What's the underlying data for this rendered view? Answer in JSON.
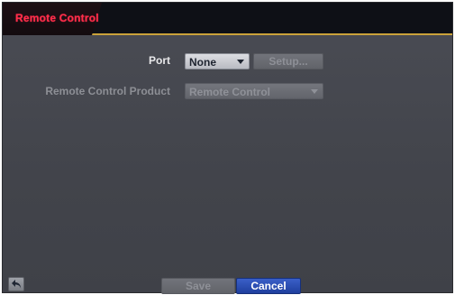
{
  "window": {
    "title": "Remote Control"
  },
  "form": {
    "port": {
      "label": "Port",
      "value": "None",
      "setup_label": "Setup..."
    },
    "product": {
      "label": "Remote Control Product",
      "value": "Remote Control"
    }
  },
  "footer": {
    "save_label": "Save",
    "cancel_label": "Cancel",
    "back_icon": "back-arrow-icon"
  },
  "colors": {
    "title": "#ff2d4a",
    "accent_line": "#caa23a",
    "primary_button": "#2a4fb8"
  }
}
